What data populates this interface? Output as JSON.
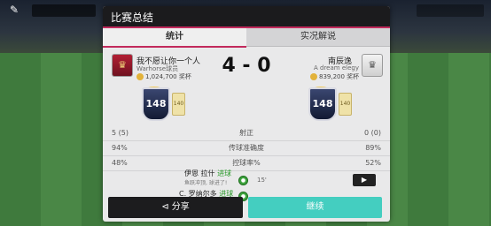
{
  "dialog": {
    "title": "比赛总结"
  },
  "tabs": [
    {
      "label": "统计"
    },
    {
      "label": "实况解说"
    }
  ],
  "home": {
    "name": "我不愿让你一个人",
    "club": "Warhorse球员",
    "coins": "1,024,700 奖杯",
    "rating": "148",
    "card": "140"
  },
  "away": {
    "name": "南辰逸",
    "club": "A dream elegy",
    "coins": "839,200 奖杯",
    "rating": "148",
    "card": "140"
  },
  "score": "4 - 0",
  "stats": [
    {
      "left": "5 (5)",
      "label": "射正",
      "right": "0 (0)"
    },
    {
      "left": "94%",
      "label": "传球准确度",
      "right": "89%"
    },
    {
      "left": "48%",
      "label": "控球率%",
      "right": "52%"
    }
  ],
  "events": [
    {
      "player": "伊恩 拉什",
      "tag": "进球",
      "detail": "鱼跃冲顶, 球进了!",
      "minute": "15'"
    },
    {
      "player": "C. 罗纳尔多",
      "tag": "进球"
    }
  ],
  "buttons": {
    "share": "分享",
    "continue": "继续"
  },
  "icons": {
    "chat": "chat-icon",
    "share": "share-icon",
    "video": "video-icon",
    "ball": "ball-icon"
  },
  "colors": {
    "accent": "#c22a5c",
    "continue": "#44cec0",
    "goal": "#2c9a2c"
  }
}
